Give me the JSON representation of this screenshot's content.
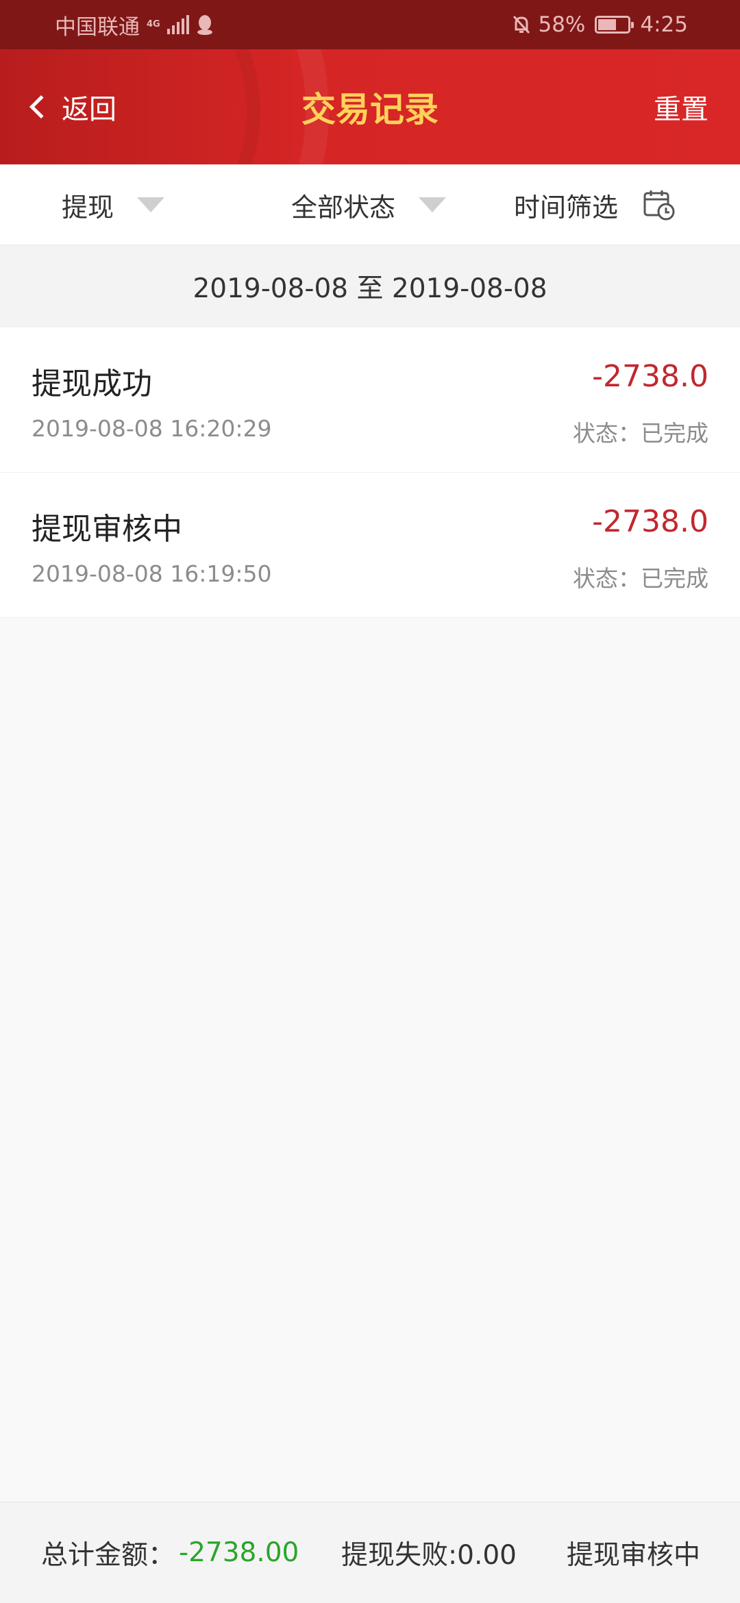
{
  "status_bar": {
    "carrier": "中国联通",
    "network": "4G",
    "battery": "58%",
    "battery_level": 0.58,
    "time": "4:25"
  },
  "header": {
    "back_label": "返回",
    "title": "交易记录",
    "reset_label": "重置"
  },
  "filters": {
    "type": "提现",
    "status": "全部状态",
    "time": "时间筛选"
  },
  "date_range": "2019-08-08 至 2019-08-08",
  "transactions": [
    {
      "name": "提现成功",
      "amount": "-2738.0",
      "time": "2019-08-08 16:20:29",
      "state": "状态：已完成"
    },
    {
      "name": "提现审核中",
      "amount": "-2738.0",
      "time": "2019-08-08 16:19:50",
      "state": "状态：已完成"
    }
  ],
  "footer": {
    "total_label": "总计金额：",
    "total_value": "-2738.00",
    "failed": "提现失败:0.00",
    "pending": "提现审核中"
  },
  "colors": {
    "header_red": "#d52525",
    "title_yellow": "#ffd25a",
    "amount_red": "#c2272d",
    "total_green": "#2aa52a"
  }
}
